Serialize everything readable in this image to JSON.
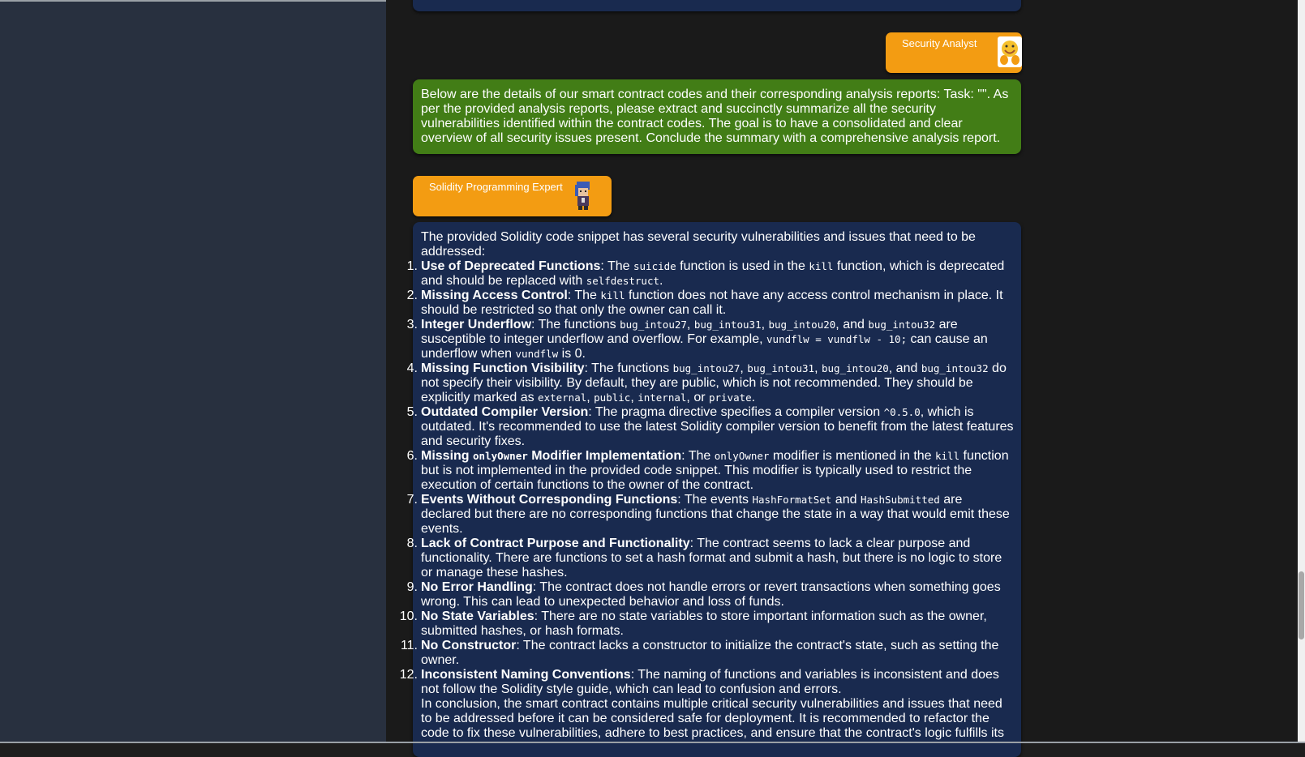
{
  "chat": {
    "analyst": {
      "role": "Security Analyst",
      "avatar_icon": "smiley-hug-icon"
    },
    "task_message": "Below are the details of our smart contract codes and their corresponding analysis reports: Task: \"\". As per the provided analysis reports, please extract and succinctly summarize all the security vulnerabilities identified within the contract codes. The goal is to have a consolidated and clear overview of all security issues present. Conclude the summary with a comprehensive analysis report.",
    "expert": {
      "role": "Solidity Programming Expert",
      "avatar_icon": "pixel-character-icon"
    },
    "response": {
      "intro": "The provided Solidity code snippet has several security vulnerabilities and issues that need to be addressed:",
      "items": [
        {
          "num": "1.",
          "title": "Use of Deprecated Functions",
          "t1": ": The ",
          "c1": "suicide",
          "t2": " function is used in the ",
          "c2": "kill",
          "t3": " function, which is deprecated and should be replaced with ",
          "c3": "selfdestruct",
          "t4": "."
        },
        {
          "num": "2.",
          "title": "Missing Access Control",
          "t1": ": The ",
          "c1": "kill",
          "t2": " function does not have any access control mechanism in place. It should be restricted so that only the owner can call it."
        },
        {
          "num": "3.",
          "title": "Integer Underflow",
          "t1": ": The functions ",
          "c1": "bug_intou27",
          "t2": ", ",
          "c2": "bug_intou31",
          "t3": ", ",
          "c3": "bug_intou20",
          "t4": ", and ",
          "c4": "bug_intou32",
          "t5": " are susceptible to integer underflow and overflow. For example, ",
          "c5": "vundflw = vundflw - 10;",
          "t6": " can cause an underflow when ",
          "c6": "vundflw",
          "t7": " is 0."
        },
        {
          "num": "4.",
          "title": "Missing Function Visibility",
          "t1": ": The functions ",
          "c1": "bug_intou27",
          "t2": ", ",
          "c2": "bug_intou31",
          "t3": ", ",
          "c3": "bug_intou20",
          "t4": ", and ",
          "c4": "bug_intou32",
          "t5": " do not specify their visibility. By default, they are public, which is not recommended. They should be explicitly marked as ",
          "c5": "external",
          "t6": ", ",
          "c6": "public",
          "t7": ", ",
          "c7": "internal",
          "t8": ", or ",
          "c8": "private",
          "t9": "."
        },
        {
          "num": "5.",
          "title": "Outdated Compiler Version",
          "t1": ": The pragma directive specifies a compiler version ",
          "c1": "^0.5.0",
          "t2": ", which is outdated. It's recommended to use the latest Solidity compiler version to benefit from the latest features and security fixes."
        },
        {
          "num": "6.",
          "title": "Missing ",
          "titlecode": "onlyOwner",
          "title2": " Modifier Implementation",
          "t1": ": The ",
          "c1": "onlyOwner",
          "t2": " modifier is mentioned in the ",
          "c2": "kill",
          "t3": " function but is not implemented in the provided code snippet. This modifier is typically used to restrict the execution of certain functions to the owner of the contract."
        },
        {
          "num": "7.",
          "title": "Events Without Corresponding Functions",
          "t1": ": The events ",
          "c1": "HashFormatSet",
          "t2": " and ",
          "c2": "HashSubmitted",
          "t3": " are declared but there are no corresponding functions that change the state in a way that would emit these events."
        },
        {
          "num": "8.",
          "title": "Lack of Contract Purpose and Functionality",
          "t1": ": The contract seems to lack a clear purpose and functionality. There are functions to set a hash format and submit a hash, but there is no logic to store or manage these hashes."
        },
        {
          "num": "9.",
          "title": "No Error Handling",
          "t1": ": The contract does not handle errors or revert transactions when something goes wrong. This can lead to unexpected behavior and loss of funds."
        },
        {
          "num": "10.",
          "title": "No State Variables",
          "t1": ": There are no state variables to store important information such as the owner, submitted hashes, or hash formats."
        },
        {
          "num": "11.",
          "title": "No Constructor",
          "t1": ": The contract lacks a constructor to initialize the contract's state, such as setting the owner."
        },
        {
          "num": "12.",
          "title": "Inconsistent Naming Conventions",
          "t1": ": The naming of functions and variables is inconsistent and does not follow the Solidity style guide, which can lead to confusion and errors."
        }
      ],
      "conclusion": "In conclusion, the smart contract contains multiple critical security vulnerabilities and issues that need to be addressed before it can be considered safe for deployment. It is recommended to refactor the code to fix these vulnerabilities, adhere to best practices, and ensure that the contract's logic fulfills its"
    }
  },
  "colors": {
    "sidebar": "#28303f",
    "chat_background": "#1a1a1a",
    "role_tag": "#f39c12",
    "user_bubble": "#427d16",
    "assistant_bubble": "#192a4f"
  }
}
